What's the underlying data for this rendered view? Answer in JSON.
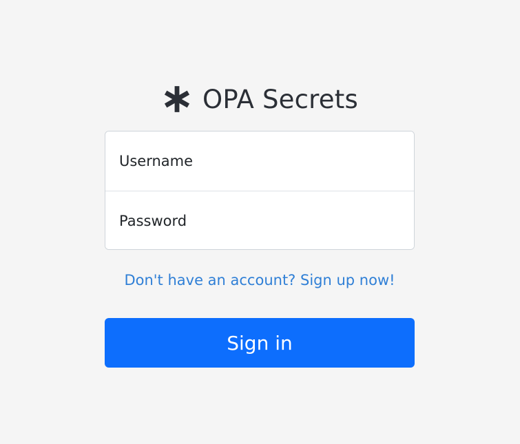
{
  "brand": {
    "icon": "asterisk-icon",
    "title": "OPA Secrets"
  },
  "form": {
    "username": {
      "placeholder": "Username",
      "value": ""
    },
    "password": {
      "placeholder": "Password",
      "value": ""
    }
  },
  "signup_link": "Don't have an account? Sign up now!",
  "signin_button": "Sign in",
  "colors": {
    "background": "#f5f5f5",
    "primary": "#0d6efd",
    "link": "#2f7fd6",
    "text": "#212529",
    "border": "#ced4da"
  }
}
